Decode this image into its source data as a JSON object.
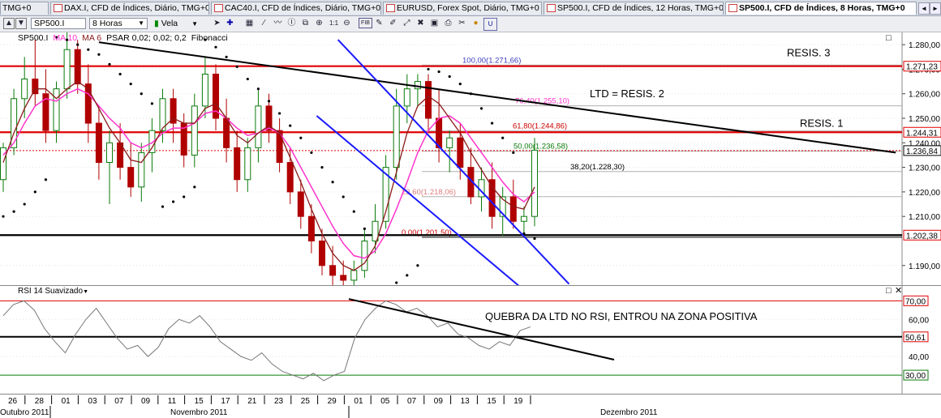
{
  "tabs": [
    {
      "label": "TMG+0",
      "active": false
    },
    {
      "label": "DAX.I, CFD de Índices, Diário, TMG+0",
      "active": false
    },
    {
      "label": "CAC40.I, CFD de Índices, Diário, TMG+0",
      "active": false
    },
    {
      "label": "EURUSD, Forex Spot, Diário, TMG+0",
      "active": false
    },
    {
      "label": "SP500.I, CFD de Índices, 12 Horas, TMG+0",
      "active": false
    },
    {
      "label": "SP500.I, CFD de Índices, 8 Horas, TMG+0",
      "active": true
    }
  ],
  "tab_nav": {
    "prev": "◄",
    "next": "►"
  },
  "toolbar": {
    "symbol": "SP500.I",
    "timeframe": "8 Horas",
    "chart_style": "Vela",
    "buttons": [
      "cursor-arrow",
      "crosshair",
      "grid",
      "line-tool",
      "text-tool",
      "trendline",
      "zoom-in",
      "zoom-out",
      "fit",
      "fib-tool",
      "pen",
      "draw",
      "expand",
      "shrink",
      "snapshot",
      "print",
      "cut",
      "bell",
      "magnet"
    ]
  },
  "legend": {
    "symbol": "SP500.I",
    "ma10": "MA 10",
    "ma6": "MA 6",
    "psar": "PSAR 0,02; 0,02; 0,2",
    "fib": "Fibonacci"
  },
  "rsi_legend": "RSI 14 Suavizado",
  "colors": {
    "resistance": "#e00000",
    "support": "#000000",
    "ma10": "#ff33cc",
    "ma6": "#8b1a1a",
    "channel": "#1a1aff",
    "fib100": "#4040c0",
    "fib764": "#ff33cc",
    "fib618": "#cc0000",
    "fib50": "#0a7a0a",
    "fib382": "#000000",
    "fib236": "#e08080",
    "fib0": "#cc0000",
    "rsi": "#777777"
  },
  "chart_data": [
    {
      "type": "candlestick",
      "title": "SP500.I, CFD de Índices, 8 Horas, TMG+0",
      "ylim": [
        1182,
        1285
      ],
      "y_ticks": [
        1280,
        1270,
        1260,
        1250,
        1240,
        1230,
        1220,
        1210,
        1190
      ],
      "y_tick_labels": [
        "1.280,00",
        "1.270,00",
        "1.260,00",
        "1.250,00",
        "1.240,00",
        "1.230,00",
        "1.220,00",
        "1.210,00",
        "1.190,00"
      ],
      "price_tags": [
        {
          "value": 1271.23,
          "label": "1.271,23",
          "color": "#e00000"
        },
        {
          "value": 1244.31,
          "label": "1.244,31",
          "color": "#e00000"
        },
        {
          "value": 1236.84,
          "label": "1.236,84",
          "color": "#000000"
        },
        {
          "value": 1202.38,
          "label": "1.202,38",
          "color": "#e00000"
        }
      ],
      "current_price": 1236.84,
      "horizontal_lines": [
        {
          "value": 1271.23,
          "name": "resistance-3"
        },
        {
          "value": 1244.31,
          "name": "resistance-1"
        },
        {
          "value": 1202.38,
          "name": "support"
        }
      ],
      "fibonacci": [
        {
          "level": "100,00",
          "price": 1271.66,
          "label": "100,00(1.271,66)"
        },
        {
          "level": "76,40",
          "price": 1255.1,
          "label": "76,40(1.255,10)"
        },
        {
          "level": "61,80",
          "price": 1244.86,
          "label": "61,80(1.244,86)"
        },
        {
          "level": "50,00",
          "price": 1236.58,
          "label": "50,00(1.236,58)"
        },
        {
          "level": "38,20",
          "price": 1228.3,
          "label": "38,20(1.228,30)"
        },
        {
          "level": "23,60",
          "price": 1218.06,
          "label": "23,60(1.218,06)"
        },
        {
          "level": "0,00",
          "price": 1201.5,
          "label": "0,00(1.201,50)"
        }
      ],
      "annotations": [
        "RESIS. 3",
        "LTD = RESIS. 2",
        "RESIS. 1"
      ],
      "trendline_ltd": [
        {
          "date_index": 9,
          "price": 1281
        },
        {
          "date_index": 42,
          "price": 1236
        }
      ],
      "channel": {
        "upper": [
          {
            "date_index": 31.5,
            "price": 1282
          },
          {
            "date_index": 39.5,
            "price": 1199
          }
        ],
        "lower": [
          {
            "date_index": 29.5,
            "price": 1251
          },
          {
            "date_index": 40.2,
            "price": 1183
          }
        ]
      },
      "candles": [
        {
          "o": 1225,
          "h": 1240,
          "l": 1220,
          "c": 1238
        },
        {
          "o": 1238,
          "h": 1262,
          "l": 1235,
          "c": 1258
        },
        {
          "o": 1258,
          "h": 1275,
          "l": 1250,
          "c": 1266
        },
        {
          "o": 1266,
          "h": 1282,
          "l": 1255,
          "c": 1260
        },
        {
          "o": 1260,
          "h": 1270,
          "l": 1240,
          "c": 1245
        },
        {
          "o": 1245,
          "h": 1265,
          "l": 1240,
          "c": 1262
        },
        {
          "o": 1262,
          "h": 1285,
          "l": 1258,
          "c": 1278
        },
        {
          "o": 1278,
          "h": 1282,
          "l": 1260,
          "c": 1264
        },
        {
          "o": 1264,
          "h": 1272,
          "l": 1240,
          "c": 1248
        },
        {
          "o": 1248,
          "h": 1255,
          "l": 1225,
          "c": 1232
        },
        {
          "o": 1232,
          "h": 1245,
          "l": 1215,
          "c": 1240
        },
        {
          "o": 1240,
          "h": 1248,
          "l": 1225,
          "c": 1230
        },
        {
          "o": 1230,
          "h": 1240,
          "l": 1218,
          "c": 1222
        },
        {
          "o": 1222,
          "h": 1240,
          "l": 1216,
          "c": 1236
        },
        {
          "o": 1236,
          "h": 1250,
          "l": 1228,
          "c": 1245
        },
        {
          "o": 1245,
          "h": 1262,
          "l": 1240,
          "c": 1258
        },
        {
          "o": 1258,
          "h": 1262,
          "l": 1240,
          "c": 1248
        },
        {
          "o": 1248,
          "h": 1252,
          "l": 1230,
          "c": 1235
        },
        {
          "o": 1235,
          "h": 1260,
          "l": 1230,
          "c": 1255
        },
        {
          "o": 1255,
          "h": 1275,
          "l": 1250,
          "c": 1268
        },
        {
          "o": 1268,
          "h": 1272,
          "l": 1245,
          "c": 1250
        },
        {
          "o": 1250,
          "h": 1258,
          "l": 1232,
          "c": 1238
        },
        {
          "o": 1238,
          "h": 1245,
          "l": 1220,
          "c": 1225
        },
        {
          "o": 1225,
          "h": 1242,
          "l": 1220,
          "c": 1238
        },
        {
          "o": 1238,
          "h": 1262,
          "l": 1232,
          "c": 1255
        },
        {
          "o": 1255,
          "h": 1260,
          "l": 1240,
          "c": 1245
        },
        {
          "o": 1245,
          "h": 1250,
          "l": 1228,
          "c": 1232
        },
        {
          "o": 1232,
          "h": 1238,
          "l": 1215,
          "c": 1220
        },
        {
          "o": 1220,
          "h": 1225,
          "l": 1205,
          "c": 1210
        },
        {
          "o": 1210,
          "h": 1215,
          "l": 1195,
          "c": 1200
        },
        {
          "o": 1200,
          "h": 1205,
          "l": 1186,
          "c": 1190
        },
        {
          "o": 1190,
          "h": 1198,
          "l": 1182,
          "c": 1186
        },
        {
          "o": 1186,
          "h": 1192,
          "l": 1182,
          "c": 1184
        },
        {
          "o": 1184,
          "h": 1192,
          "l": 1182,
          "c": 1188
        },
        {
          "o": 1188,
          "h": 1205,
          "l": 1185,
          "c": 1200
        },
        {
          "o": 1200,
          "h": 1215,
          "l": 1195,
          "c": 1208
        },
        {
          "o": 1208,
          "h": 1235,
          "l": 1205,
          "c": 1230
        },
        {
          "o": 1230,
          "h": 1262,
          "l": 1225,
          "c": 1255
        },
        {
          "o": 1255,
          "h": 1268,
          "l": 1248,
          "c": 1262
        },
        {
          "o": 1262,
          "h": 1268,
          "l": 1255,
          "c": 1265
        },
        {
          "o": 1265,
          "h": 1268,
          "l": 1245,
          "c": 1250
        },
        {
          "o": 1250,
          "h": 1262,
          "l": 1232,
          "c": 1238
        },
        {
          "o": 1238,
          "h": 1245,
          "l": 1228,
          "c": 1242
        },
        {
          "o": 1242,
          "h": 1248,
          "l": 1225,
          "c": 1230
        },
        {
          "o": 1230,
          "h": 1238,
          "l": 1215,
          "c": 1218
        },
        {
          "o": 1218,
          "h": 1230,
          "l": 1212,
          "c": 1225
        },
        {
          "o": 1225,
          "h": 1232,
          "l": 1205,
          "c": 1210
        },
        {
          "o": 1210,
          "h": 1222,
          "l": 1202,
          "c": 1218
        },
        {
          "o": 1218,
          "h": 1225,
          "l": 1205,
          "c": 1208
        },
        {
          "o": 1208,
          "h": 1214,
          "l": 1202,
          "c": 1210
        },
        {
          "o": 1210,
          "h": 1242,
          "l": 1206,
          "c": 1237
        }
      ],
      "ma10": [
        1235,
        1240,
        1248,
        1255,
        1258,
        1257,
        1260,
        1262,
        1260,
        1255,
        1250,
        1246,
        1240,
        1238,
        1240,
        1244,
        1246,
        1246,
        1248,
        1252,
        1253,
        1250,
        1246,
        1243,
        1244,
        1246,
        1244,
        1238,
        1230,
        1222,
        1214,
        1206,
        1199,
        1194,
        1193,
        1196,
        1203,
        1213,
        1224,
        1236,
        1245,
        1250,
        1251,
        1248,
        1242,
        1236,
        1230,
        1224,
        1219,
        1216,
        1220
      ],
      "ma6": [
        1232,
        1244,
        1254,
        1262,
        1262,
        1258,
        1262,
        1265,
        1262,
        1254,
        1246,
        1240,
        1233,
        1232,
        1238,
        1246,
        1250,
        1248,
        1248,
        1254,
        1256,
        1250,
        1243,
        1240,
        1244,
        1247,
        1244,
        1234,
        1224,
        1213,
        1203,
        1195,
        1190,
        1188,
        1191,
        1198,
        1212,
        1228,
        1244,
        1255,
        1259,
        1256,
        1250,
        1244,
        1236,
        1229,
        1222,
        1217,
        1214,
        1213,
        1222
      ],
      "psar": [
        1210,
        1212,
        1215,
        1220,
        1225,
        1283,
        1282,
        1280,
        1278,
        1276,
        1272,
        1268,
        1264,
        1260,
        1256,
        1214,
        1216,
        1218,
        1222,
        1282,
        1279,
        1275,
        1271,
        1266,
        1262,
        1257,
        1252,
        1247,
        1242,
        1236,
        1230,
        1224,
        1218,
        1212,
        1205,
        1180,
        1181,
        1183,
        1186,
        1190,
        1270,
        1269,
        1267,
        1264,
        1260,
        1254,
        1248,
        1242,
        1236,
        1203,
        1201
      ]
    },
    {
      "type": "line",
      "title": "RSI 14 Suavizado",
      "ylim": [
        20,
        78
      ],
      "y_ticks": [
        60,
        40
      ],
      "y_tick_labels": [
        "60,00",
        "40,00"
      ],
      "levels": [
        {
          "value": 70,
          "label": "70,00",
          "color": "#e00000"
        },
        {
          "value": 30,
          "label": "30,00",
          "color": "#0a7a0a"
        }
      ],
      "current": {
        "value": 50.61,
        "label": "50,61"
      },
      "annotation": "QUEBRA DA LTD NO RSI, ENTROU NA ZONA POSITIVA",
      "trendline": [
        {
          "date_index": 27,
          "value": 71
        },
        {
          "date_index": 47,
          "value": 37
        }
      ],
      "values": [
        62,
        68,
        70,
        65,
        55,
        48,
        42,
        52,
        60,
        66,
        58,
        50,
        44,
        46,
        40,
        45,
        55,
        60,
        58,
        62,
        56,
        48,
        44,
        40,
        38,
        42,
        36,
        32,
        30,
        28,
        31,
        27,
        30,
        32,
        50,
        60,
        66,
        70,
        68,
        64,
        66,
        62,
        56,
        58,
        52,
        50,
        46,
        44,
        48,
        46,
        54,
        56
      ]
    }
  ],
  "x_axis": {
    "labels": [
      "26",
      "28",
      "01",
      "03",
      "07",
      "09",
      "11",
      "15",
      "17",
      "21",
      "23",
      "25",
      "29",
      "01",
      "05",
      "07",
      "09",
      "13",
      "15",
      "19"
    ],
    "months": [
      {
        "label": "Outubro 2011"
      },
      {
        "label": "Novembro 2011"
      },
      {
        "label": "Dezembro 2011"
      }
    ]
  }
}
